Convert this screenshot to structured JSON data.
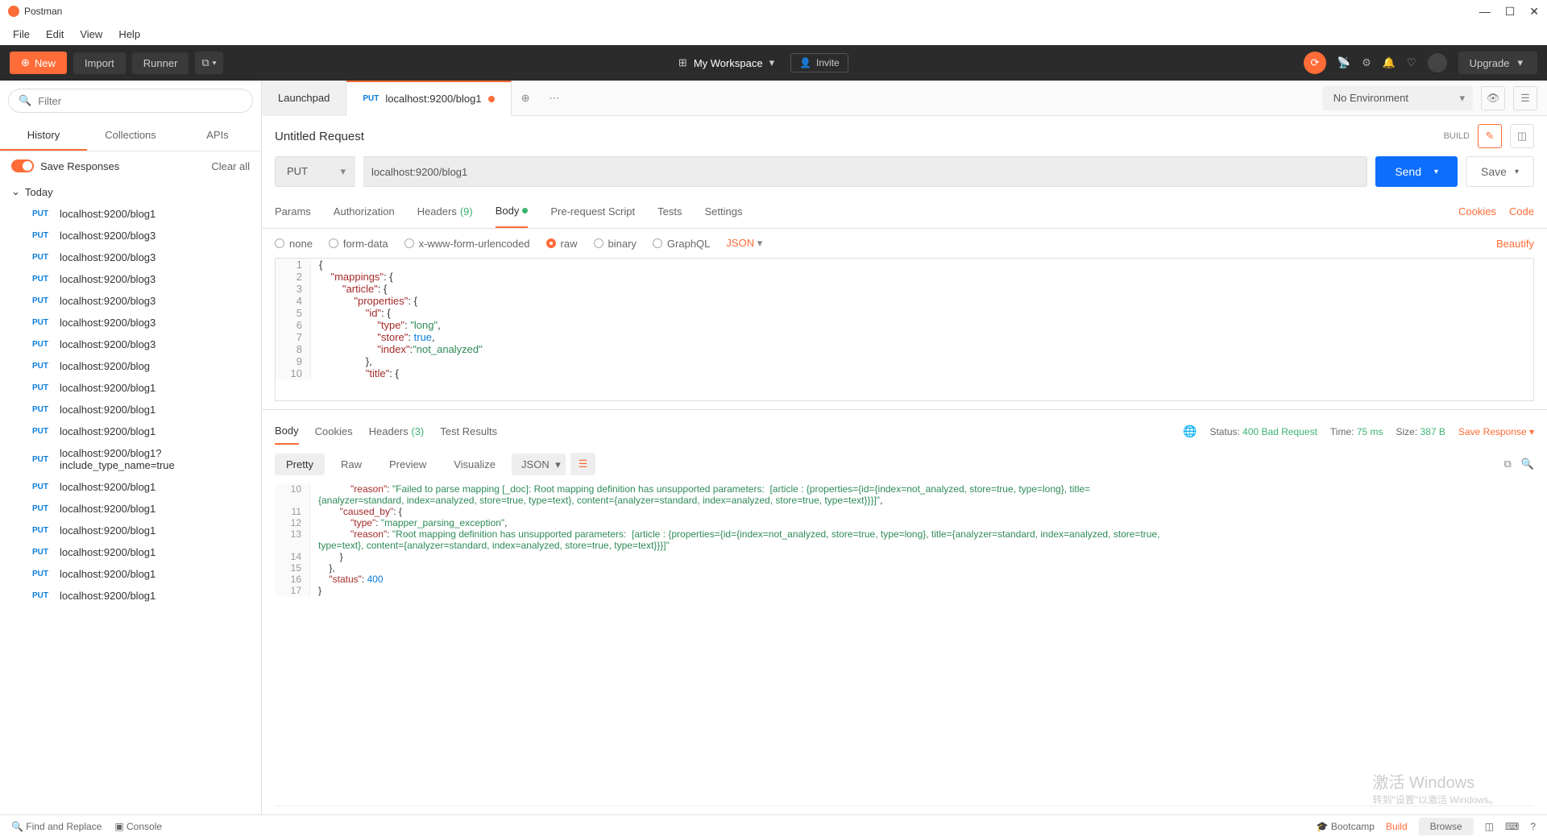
{
  "window": {
    "title": "Postman"
  },
  "menu": {
    "file": "File",
    "edit": "Edit",
    "view": "View",
    "help": "Help"
  },
  "toolbar": {
    "new": "New",
    "import": "Import",
    "runner": "Runner",
    "workspace": "My Workspace",
    "invite": "Invite",
    "upgrade": "Upgrade"
  },
  "sidebar": {
    "filter_placeholder": "Filter",
    "tabs": {
      "history": "History",
      "collections": "Collections",
      "apis": "APIs"
    },
    "save_responses": "Save Responses",
    "clear_all": "Clear all",
    "group": "Today",
    "items": [
      {
        "method": "PUT",
        "url": "localhost:9200/blog1"
      },
      {
        "method": "PUT",
        "url": "localhost:9200/blog3"
      },
      {
        "method": "PUT",
        "url": "localhost:9200/blog3"
      },
      {
        "method": "PUT",
        "url": "localhost:9200/blog3"
      },
      {
        "method": "PUT",
        "url": "localhost:9200/blog3"
      },
      {
        "method": "PUT",
        "url": "localhost:9200/blog3"
      },
      {
        "method": "PUT",
        "url": "localhost:9200/blog3"
      },
      {
        "method": "PUT",
        "url": "localhost:9200/blog"
      },
      {
        "method": "PUT",
        "url": "localhost:9200/blog1"
      },
      {
        "method": "PUT",
        "url": "localhost:9200/blog1"
      },
      {
        "method": "PUT",
        "url": "localhost:9200/blog1"
      },
      {
        "method": "PUT",
        "url": "localhost:9200/blog1?include_type_name=true"
      },
      {
        "method": "PUT",
        "url": "localhost:9200/blog1"
      },
      {
        "method": "PUT",
        "url": "localhost:9200/blog1"
      },
      {
        "method": "PUT",
        "url": "localhost:9200/blog1"
      },
      {
        "method": "PUT",
        "url": "localhost:9200/blog1"
      },
      {
        "method": "PUT",
        "url": "localhost:9200/blog1"
      },
      {
        "method": "PUT",
        "url": "localhost:9200/blog1"
      }
    ]
  },
  "tabs": {
    "launchpad": "Launchpad",
    "active": {
      "method": "PUT",
      "url": "localhost:9200/blog1"
    },
    "environment": "No Environment"
  },
  "request": {
    "title": "Untitled Request",
    "build": "BUILD",
    "method": "PUT",
    "url": "localhost:9200/blog1",
    "send": "Send",
    "save": "Save",
    "tabs": {
      "params": "Params",
      "auth": "Authorization",
      "headers": "Headers",
      "headers_count": "(9)",
      "body": "Body",
      "prereq": "Pre-request Script",
      "tests": "Tests",
      "settings": "Settings"
    },
    "cookies": "Cookies",
    "code": "Code",
    "body_types": {
      "none": "none",
      "formdata": "form-data",
      "urlenc": "x-www-form-urlencoded",
      "raw": "raw",
      "binary": "binary",
      "graphql": "GraphQL"
    },
    "raw_type": "JSON",
    "beautify": "Beautify",
    "editor_lines": [
      {
        "n": "1",
        "html": "{"
      },
      {
        "n": "2",
        "html": "    <span class='json-key'>\"mappings\"</span>: {"
      },
      {
        "n": "3",
        "html": "        <span class='json-key'>\"article\"</span>: {"
      },
      {
        "n": "4",
        "html": "            <span class='json-key'>\"properties\"</span>: {"
      },
      {
        "n": "5",
        "html": "                <span class='json-key'>\"id\"</span>: {"
      },
      {
        "n": "6",
        "html": "                    <span class='json-key'>\"type\"</span>: <span class='json-str'>\"long\"</span>,"
      },
      {
        "n": "7",
        "html": "                    <span class='json-key'>\"store\"</span>: <span class='json-bool'>true</span>,"
      },
      {
        "n": "8",
        "html": "                    <span class='json-key'>\"index\"</span>:<span class='json-str'>\"not_analyzed\"</span>"
      },
      {
        "n": "9",
        "html": "                },"
      },
      {
        "n": "10",
        "html": "                <span class='json-key'>\"title\"</span>: {"
      }
    ]
  },
  "response": {
    "tabs": {
      "body": "Body",
      "cookies": "Cookies",
      "headers": "Headers",
      "headers_count": "(3)",
      "tests": "Test Results"
    },
    "status_label": "Status:",
    "status": "400 Bad Request",
    "time_label": "Time:",
    "time": "75 ms",
    "size_label": "Size:",
    "size": "387 B",
    "save": "Save Response",
    "views": {
      "pretty": "Pretty",
      "raw": "Raw",
      "preview": "Preview",
      "visualize": "Visualize"
    },
    "format": "JSON",
    "lines": [
      {
        "n": "10",
        "html": "            <span class='json-key'>\"reason\"</span>: <span class='json-str'>\"Failed to parse mapping [_doc]: Root mapping definition has unsupported parameters:  [article : {properties={id={index=not_analyzed, store=true, type=long}, title={analyzer=standard, index=analyzed, store=true, type=text}, content={analyzer=standard, index=analyzed, store=true, type=text}}}]\"</span>,"
      },
      {
        "n": "11",
        "html": "        <span class='json-key'>\"caused_by\"</span>: {"
      },
      {
        "n": "12",
        "html": "            <span class='json-key'>\"type\"</span>: <span class='json-str'>\"mapper_parsing_exception\"</span>,"
      },
      {
        "n": "13",
        "html": "            <span class='json-key'>\"reason\"</span>: <span class='json-str'>\"Root mapping definition has unsupported parameters:  [article : {properties={id={index=not_analyzed, store=true, type=long}, title={analyzer=standard, index=analyzed, store=true, type=text}, content={analyzer=standard, index=analyzed, store=true, type=text}}}]\"</span>"
      },
      {
        "n": "14",
        "html": "        }"
      },
      {
        "n": "15",
        "html": "    },"
      },
      {
        "n": "16",
        "html": "    <span class='json-key'>\"status\"</span>: <span class='json-bool'>400</span>"
      },
      {
        "n": "17",
        "html": "}"
      }
    ]
  },
  "statusbar": {
    "find": "Find and Replace",
    "console": "Console",
    "bootcamp": "Bootcamp",
    "build": "Build",
    "browse": "Browse"
  },
  "watermark": {
    "line1": "激活 Windows",
    "line2": "转到\"设置\"以激活 Windows。"
  }
}
